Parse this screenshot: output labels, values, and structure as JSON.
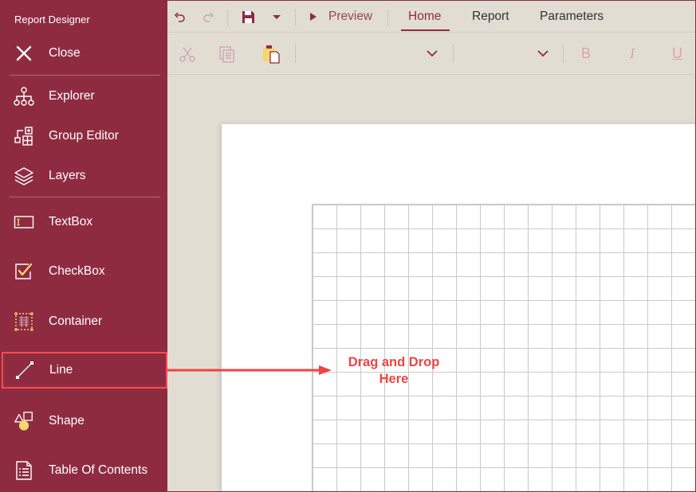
{
  "sidebar": {
    "title": "Report Designer",
    "close_label": "Close",
    "items": [
      {
        "label": "Explorer",
        "icon": "hierarchy-icon"
      },
      {
        "label": "Group Editor",
        "icon": "group-editor-icon"
      },
      {
        "label": "Layers",
        "icon": "layers-icon"
      },
      {
        "label": "TextBox",
        "icon": "textbox-icon"
      },
      {
        "label": "CheckBox",
        "icon": "checkbox-icon"
      },
      {
        "label": "Container",
        "icon": "container-icon"
      },
      {
        "label": "Line",
        "icon": "line-icon",
        "selected": true
      },
      {
        "label": "Shape",
        "icon": "shape-icon"
      },
      {
        "label": "Table Of Contents",
        "icon": "toc-icon"
      }
    ]
  },
  "toolbar": {
    "preview_label": "Preview",
    "tabs": [
      {
        "label": "Home",
        "active": true
      },
      {
        "label": "Report",
        "active": false
      },
      {
        "label": "Parameters",
        "active": false
      }
    ],
    "format": {
      "bold": "B",
      "italic": "I",
      "underline": "U"
    }
  },
  "canvas": {
    "annotation_line1": "Drag and Drop",
    "annotation_line2": "Here"
  },
  "colors": {
    "accent": "#8f2b40",
    "highlight": "#ff4d4d",
    "annotation": "#ee4444",
    "icon_yellow": "#f5d76e"
  }
}
